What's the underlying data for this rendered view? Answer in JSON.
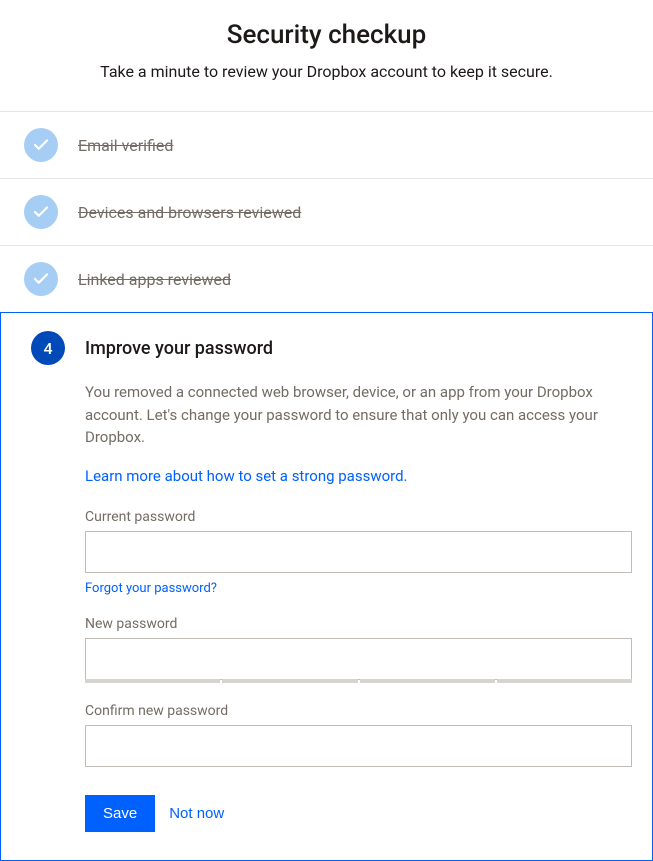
{
  "header": {
    "title": "Security checkup",
    "subtitle": "Take a minute to review your Dropbox account to keep it secure."
  },
  "steps": {
    "completed": [
      "Email verified",
      "Devices and browsers reviewed",
      "Linked apps reviewed"
    ],
    "active": {
      "number": "4",
      "title": "Improve your password",
      "description": "You removed a connected web browser, device, or an app from your Dropbox account. Let's change your password to ensure that only you can access your Dropbox.",
      "learn_more": "Learn more about how to set a strong password."
    }
  },
  "form": {
    "current_label": "Current password",
    "current_value": "",
    "forgot_link": "Forgot your password?",
    "new_label": "New password",
    "new_value": "",
    "confirm_label": "Confirm new password",
    "confirm_value": ""
  },
  "buttons": {
    "save": "Save",
    "not_now": "Not now"
  }
}
